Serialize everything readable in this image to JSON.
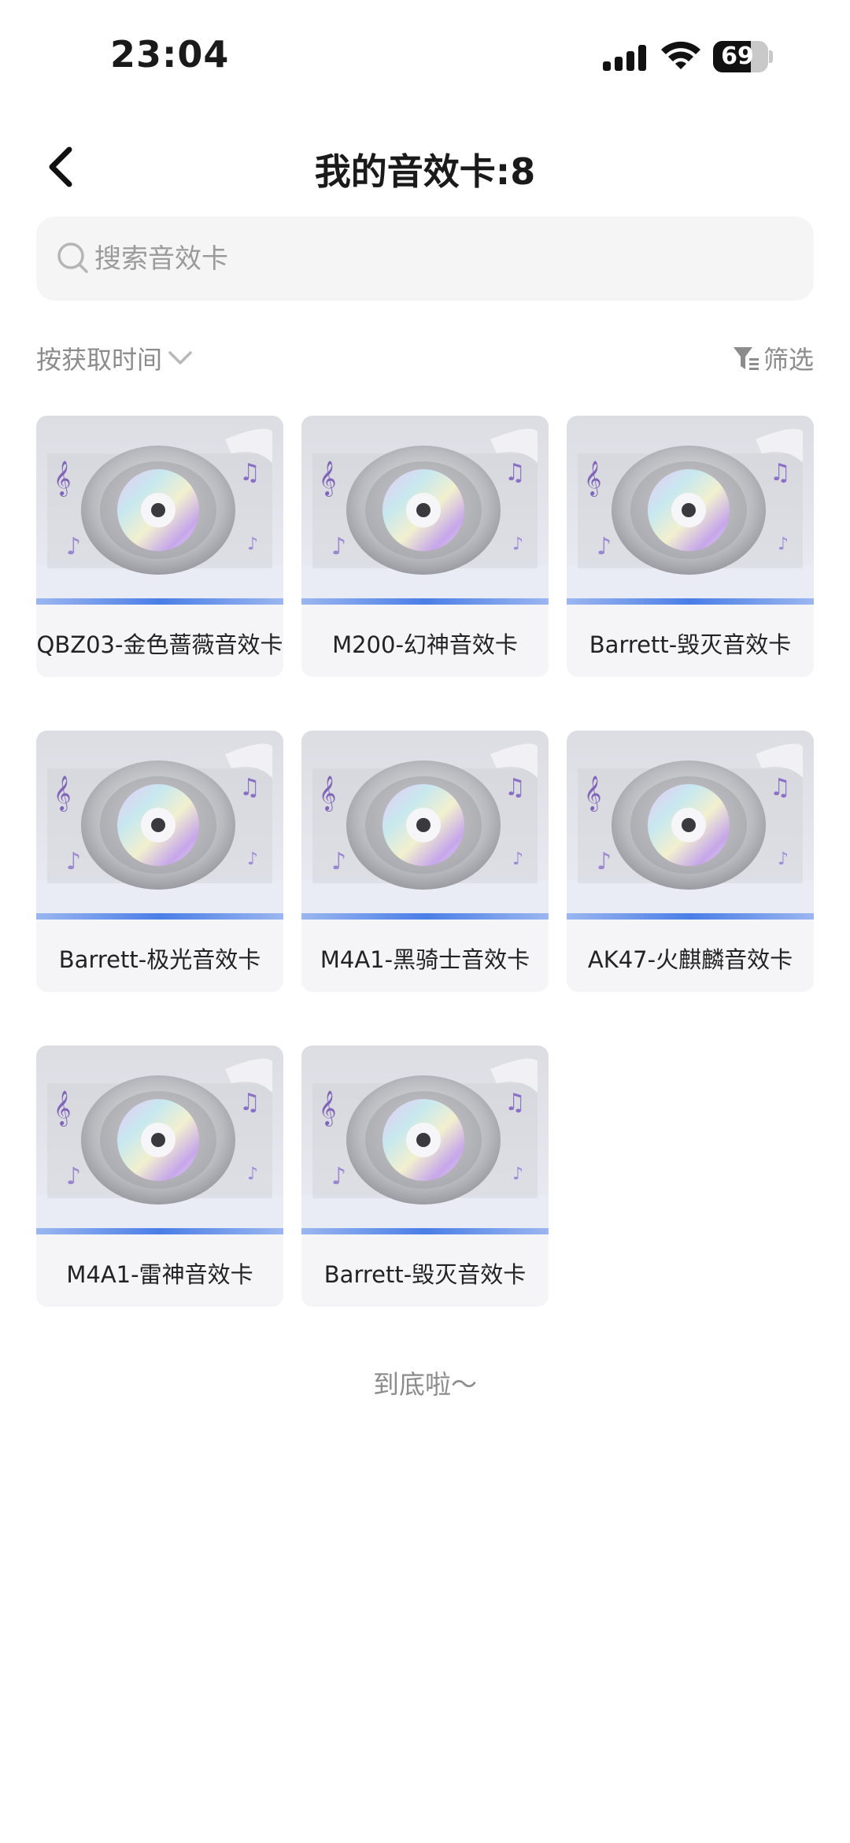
{
  "status_bar": {
    "time": "23:04",
    "battery": "69",
    "battery_level": 0.69,
    "icons": [
      "signal-icon",
      "wifi-icon",
      "battery-icon"
    ]
  },
  "header": {
    "title": "我的音效卡:8",
    "back_icon": "chevron-left-icon"
  },
  "search": {
    "placeholder": "搜索音效卡",
    "value": ""
  },
  "toolbar": {
    "sort_label": "按获取时间",
    "filter_label": "筛选"
  },
  "cards": [
    {
      "name": "QBZ03-金色蔷薇音效卡"
    },
    {
      "name": "M200-幻神音效卡"
    },
    {
      "name": "Barrett-毁灭音效卡"
    },
    {
      "name": "Barrett-极光音效卡"
    },
    {
      "name": "M4A1-黑骑士音效卡"
    },
    {
      "name": "AK47-火麒麟音效卡"
    },
    {
      "name": "M4A1-雷神音效卡"
    },
    {
      "name": "Barrett-毁灭音效卡"
    }
  ],
  "footer": {
    "end_text": "到底啦～"
  },
  "colors": {
    "accent_line": "#4a7ee6",
    "card_bg": "#f5f5f7",
    "muted_text": "#8c8c8c"
  }
}
